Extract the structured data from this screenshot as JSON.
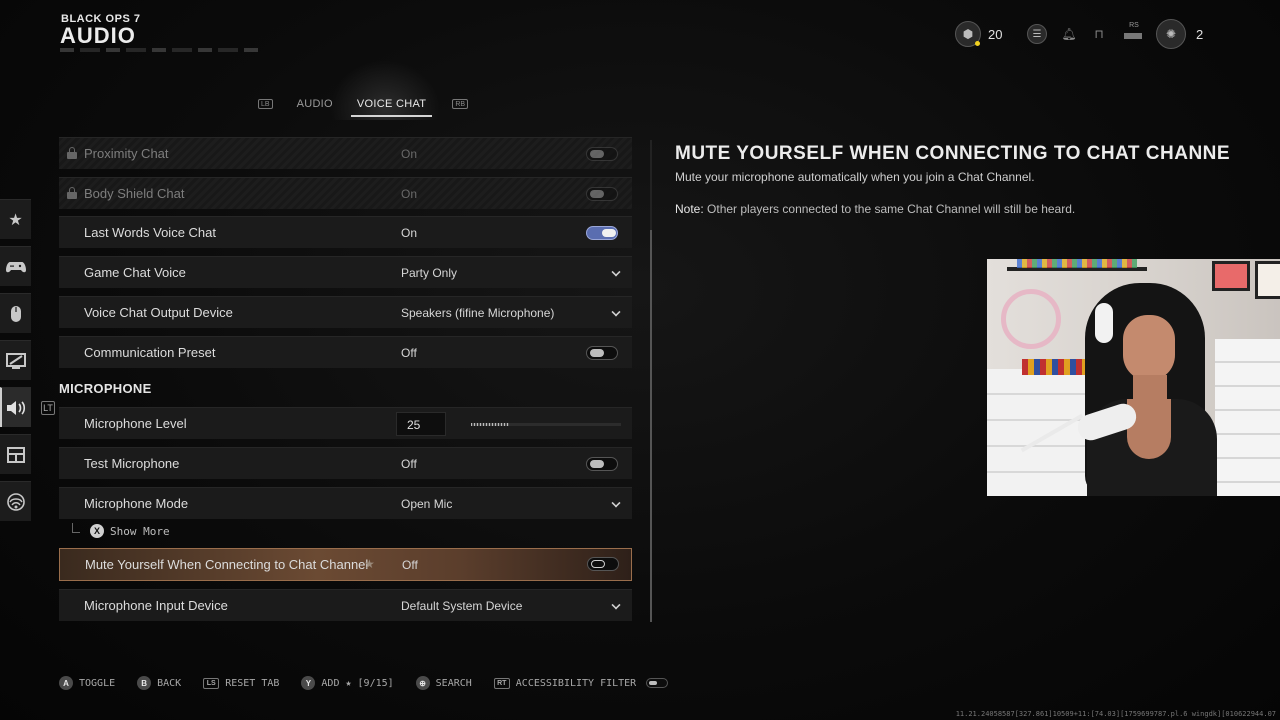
{
  "header": {
    "game_logo": "BLACK OPS 7",
    "title": "AUDIO",
    "hud": {
      "currency_value": "20",
      "party_count": "2",
      "rs_label": "RS"
    }
  },
  "tabs": {
    "left_bumper": "LB",
    "right_bumper": "RB",
    "items": [
      {
        "label": "AUDIO",
        "active": false
      },
      {
        "label": "VOICE CHAT",
        "active": true
      }
    ]
  },
  "sidebar": {
    "items": [
      {
        "icon": "star-icon",
        "active": false
      },
      {
        "icon": "controller-icon",
        "active": false
      },
      {
        "icon": "mouse-icon",
        "active": false
      },
      {
        "icon": "graphics-icon",
        "active": false
      },
      {
        "icon": "speaker-icon",
        "active": true
      },
      {
        "icon": "interface-icon",
        "active": false
      },
      {
        "icon": "network-icon",
        "active": false
      }
    ],
    "marker": "LT"
  },
  "settings": {
    "rows": [
      {
        "label": "Proximity Chat",
        "value": "On",
        "control": "toggle",
        "state": "dim",
        "locked": true
      },
      {
        "label": "Body Shield Chat",
        "value": "On",
        "control": "toggle",
        "state": "dim",
        "locked": true
      },
      {
        "label": "Last Words Voice Chat",
        "value": "On",
        "control": "toggle",
        "state": "on",
        "locked": false
      },
      {
        "label": "Game Chat Voice",
        "value": "Party Only",
        "control": "dropdown",
        "locked": false
      },
      {
        "label": "Voice Chat Output Device",
        "value": "Speakers (fifine Microphone)",
        "control": "dropdown",
        "locked": false
      },
      {
        "label": "Communication Preset",
        "value": "Off",
        "control": "toggle",
        "state": "off",
        "locked": false
      }
    ],
    "microphone_section": "MICROPHONE",
    "mic_rows": [
      {
        "label": "Microphone Level",
        "value": "25",
        "control": "slider",
        "level_percent": 25
      },
      {
        "label": "Test Microphone",
        "value": "Off",
        "control": "toggle",
        "state": "off"
      },
      {
        "label": "Microphone Mode",
        "value": "Open Mic",
        "control": "dropdown"
      }
    ],
    "show_more": {
      "button": "X",
      "label": "Show More"
    },
    "selected_row": {
      "label": "Mute Yourself When Connecting to Chat Channel",
      "value": "Off",
      "control": "toggle",
      "state": "off",
      "favorite": true
    },
    "last_row": {
      "label": "Microphone Input Device",
      "value": "Default System Device",
      "control": "dropdown"
    }
  },
  "description": {
    "title": "MUTE YOURSELF WHEN CONNECTING TO CHAT CHANNE",
    "body": "Mute your microphone automatically when you join a Chat Channel.",
    "note_label": "Note:",
    "note_text": "Other players connected to the same Chat Channel will still be heard."
  },
  "bottom_bar": {
    "hints": [
      {
        "button": "A",
        "label": "TOGGLE"
      },
      {
        "button": "B",
        "label": "BACK"
      },
      {
        "button": "LS",
        "label": "RESET TAB"
      },
      {
        "button": "Y",
        "label": "ADD ★ [9/15]"
      },
      {
        "button": "⊕",
        "label": "SEARCH"
      },
      {
        "button": "RT",
        "label": "ACCESSIBILITY FILTER"
      }
    ]
  },
  "debug_text": "11.21.24058587[327.861]10509+11:[74.03][1759699787.pl.6 wingdk][010622944.07"
}
